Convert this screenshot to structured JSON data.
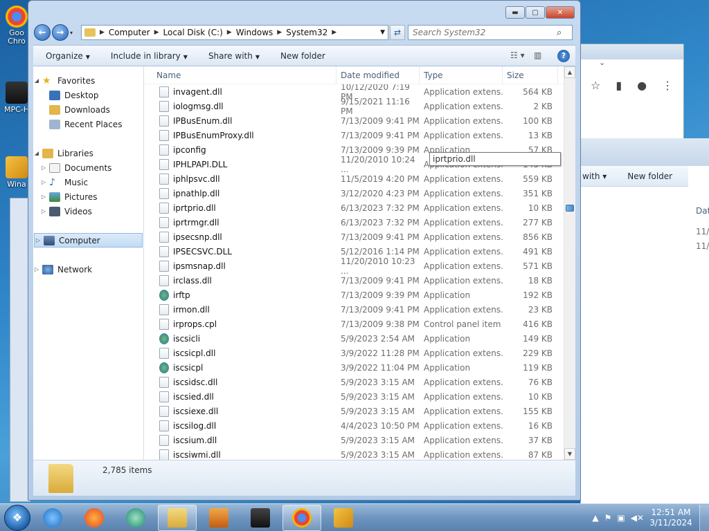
{
  "desktop": {
    "icons": [
      {
        "label": "Goo\nChro",
        "name": "chrome-desktop-icon"
      },
      {
        "label": "MPC-H",
        "name": "mpc-desktop-icon"
      },
      {
        "label": "Wina",
        "name": "winamp-desktop-icon"
      }
    ]
  },
  "background_window": {
    "cmd_share": "with ▾",
    "cmd_newfolder": "New folder",
    "col_date": "Dat",
    "date1": "11/",
    "date2": "11/("
  },
  "window": {
    "caption": {
      "minimize": "▬",
      "maximize": "▢",
      "close": "✕"
    },
    "address": {
      "crumbs": [
        "Computer",
        "Local Disk (C:)",
        "Windows",
        "System32"
      ]
    },
    "search": {
      "placeholder": "Search System32"
    },
    "commands": {
      "organize": "Organize",
      "include": "Include in library",
      "share": "Share with",
      "newfolder": "New folder"
    },
    "navpane": {
      "favorites": "Favorites",
      "desktop": "Desktop",
      "downloads": "Downloads",
      "recent": "Recent Places",
      "libraries": "Libraries",
      "documents": "Documents",
      "music": "Music",
      "pictures": "Pictures",
      "videos": "Videos",
      "computer": "Computer",
      "network": "Network"
    },
    "columns": {
      "name": "Name",
      "date": "Date modified",
      "type": "Type",
      "size": "Size"
    },
    "files": [
      {
        "name": "invagent.dll",
        "date": "10/12/2020 7:19 PM",
        "type": "Application extens...",
        "size": "564 KB",
        "icon": "dll"
      },
      {
        "name": "iologmsg.dll",
        "date": "9/15/2021 11:16 PM",
        "type": "Application extens...",
        "size": "2 KB",
        "icon": "dll"
      },
      {
        "name": "IPBusEnum.dll",
        "date": "7/13/2009 9:41 PM",
        "type": "Application extens...",
        "size": "100 KB",
        "icon": "dll"
      },
      {
        "name": "IPBusEnumProxy.dll",
        "date": "7/13/2009 9:41 PM",
        "type": "Application extens...",
        "size": "13 KB",
        "icon": "dll"
      },
      {
        "name": "ipconfig",
        "date": "7/13/2009 9:39 PM",
        "type": "Application",
        "size": "57 KB",
        "icon": "exe"
      },
      {
        "name": "IPHLPAPI.DLL",
        "date": "11/20/2010 10:24 ...",
        "type": "Application extens...",
        "size": "145 KB",
        "icon": "dll"
      },
      {
        "name": "iphlpsvc.dll",
        "date": "11/5/2019 4:20 PM",
        "type": "Application extens...",
        "size": "559 KB",
        "icon": "dll"
      },
      {
        "name": "ipnathlp.dll",
        "date": "3/12/2020 4:23 PM",
        "type": "Application extens...",
        "size": "351 KB",
        "icon": "dll"
      },
      {
        "name": "iprtprio.dll",
        "date": "6/13/2023 7:32 PM",
        "type": "Application extens...",
        "size": "10 KB",
        "icon": "dll"
      },
      {
        "name": "iprtrmgr.dll",
        "date": "6/13/2023 7:32 PM",
        "type": "Application extens...",
        "size": "277 KB",
        "icon": "dll"
      },
      {
        "name": "ipsecsnp.dll",
        "date": "7/13/2009 9:41 PM",
        "type": "Application extens...",
        "size": "856 KB",
        "icon": "dll"
      },
      {
        "name": "IPSECSVC.DLL",
        "date": "5/12/2016 1:14 PM",
        "type": "Application extens...",
        "size": "491 KB",
        "icon": "dll"
      },
      {
        "name": "ipsmsnap.dll",
        "date": "11/20/2010 10:23 ...",
        "type": "Application extens...",
        "size": "571 KB",
        "icon": "dll"
      },
      {
        "name": "irclass.dll",
        "date": "7/13/2009 9:41 PM",
        "type": "Application extens...",
        "size": "18 KB",
        "icon": "dll"
      },
      {
        "name": "irftp",
        "date": "7/13/2009 9:39 PM",
        "type": "Application",
        "size": "192 KB",
        "icon": "app"
      },
      {
        "name": "irmon.dll",
        "date": "7/13/2009 9:41 PM",
        "type": "Application extens...",
        "size": "23 KB",
        "icon": "dll"
      },
      {
        "name": "irprops.cpl",
        "date": "7/13/2009 9:38 PM",
        "type": "Control panel item",
        "size": "416 KB",
        "icon": "dll"
      },
      {
        "name": "iscsicli",
        "date": "5/9/2023 2:54 AM",
        "type": "Application",
        "size": "149 KB",
        "icon": "app"
      },
      {
        "name": "iscsicpl.dll",
        "date": "3/9/2022 11:28 PM",
        "type": "Application extens...",
        "size": "229 KB",
        "icon": "dll"
      },
      {
        "name": "iscsicpl",
        "date": "3/9/2022 11:04 PM",
        "type": "Application",
        "size": "119 KB",
        "icon": "app"
      },
      {
        "name": "iscsidsc.dll",
        "date": "5/9/2023 3:15 AM",
        "type": "Application extens...",
        "size": "76 KB",
        "icon": "dll"
      },
      {
        "name": "iscsied.dll",
        "date": "5/9/2023 3:15 AM",
        "type": "Application extens...",
        "size": "10 KB",
        "icon": "dll"
      },
      {
        "name": "iscsiexe.dll",
        "date": "5/9/2023 3:15 AM",
        "type": "Application extens...",
        "size": "155 KB",
        "icon": "dll"
      },
      {
        "name": "iscsilog.dll",
        "date": "4/4/2023 10:50 PM",
        "type": "Application extens...",
        "size": "16 KB",
        "icon": "dll"
      },
      {
        "name": "iscsium.dll",
        "date": "5/9/2023 3:15 AM",
        "type": "Application extens...",
        "size": "37 KB",
        "icon": "dll"
      },
      {
        "name": "iscsiwmi.dll",
        "date": "5/9/2023 3:15 AM",
        "type": "Application extens...",
        "size": "87 KB",
        "icon": "dll"
      }
    ],
    "tooltip": "iprtprio.dll",
    "status": {
      "items": "2,785 items"
    }
  },
  "taskbar": {
    "clock_time": "12:51 AM",
    "clock_date": "3/11/2024"
  },
  "colors": {
    "accent": "#2864b8",
    "selection": "#c3dcf5",
    "taskbar": "#6e95c0"
  }
}
